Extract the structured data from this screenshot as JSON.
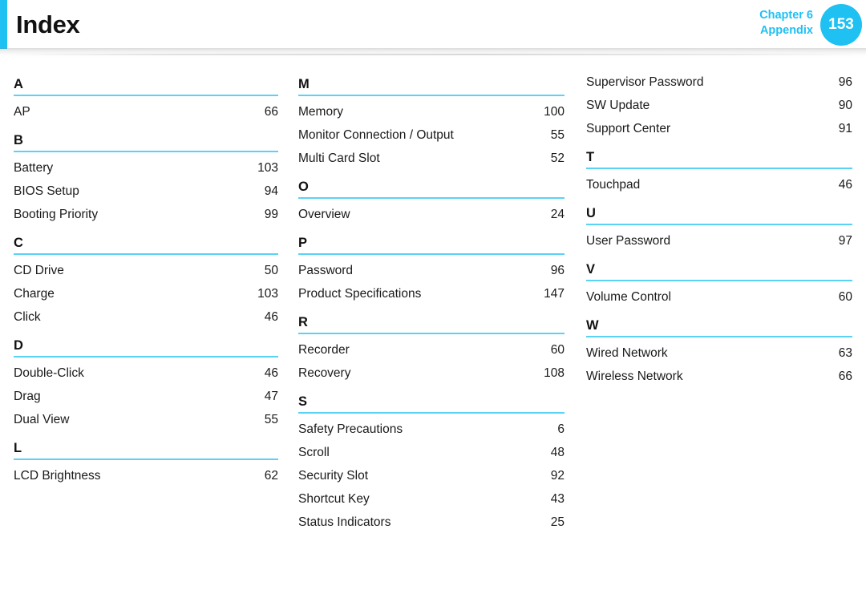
{
  "header": {
    "title": "Index",
    "chapter_line1": "Chapter 6",
    "chapter_line2": "Appendix",
    "page_number": "153",
    "accent_color": "#1fc0f2",
    "rule_color": "#5ad2f6"
  },
  "columns": [
    {
      "sections": [
        {
          "letter": "A",
          "entries": [
            {
              "label": "AP",
              "page": "66"
            }
          ]
        },
        {
          "letter": "B",
          "entries": [
            {
              "label": "Battery",
              "page": "103"
            },
            {
              "label": "BIOS Setup",
              "page": "94"
            },
            {
              "label": "Booting Priority",
              "page": "99"
            }
          ]
        },
        {
          "letter": "C",
          "entries": [
            {
              "label": "CD Drive",
              "page": "50"
            },
            {
              "label": "Charge",
              "page": "103"
            },
            {
              "label": "Click",
              "page": "46"
            }
          ]
        },
        {
          "letter": "D",
          "entries": [
            {
              "label": "Double-Click",
              "page": "46"
            },
            {
              "label": "Drag",
              "page": "47"
            },
            {
              "label": "Dual View",
              "page": "55"
            }
          ]
        },
        {
          "letter": "L",
          "entries": [
            {
              "label": "LCD Brightness",
              "page": "62"
            }
          ]
        }
      ]
    },
    {
      "sections": [
        {
          "letter": "M",
          "entries": [
            {
              "label": "Memory",
              "page": "100"
            },
            {
              "label": "Monitor Connection / Output",
              "page": "55"
            },
            {
              "label": "Multi Card Slot",
              "page": "52"
            }
          ]
        },
        {
          "letter": "O",
          "entries": [
            {
              "label": "Overview",
              "page": "24"
            }
          ]
        },
        {
          "letter": "P",
          "entries": [
            {
              "label": "Password",
              "page": "96"
            },
            {
              "label": "Product Specifications",
              "page": "147"
            }
          ]
        },
        {
          "letter": "R",
          "entries": [
            {
              "label": "Recorder",
              "page": "60"
            },
            {
              "label": "Recovery",
              "page": "108"
            }
          ]
        },
        {
          "letter": "S",
          "entries": [
            {
              "label": "Safety Precautions",
              "page": "6"
            },
            {
              "label": "Scroll",
              "page": "48"
            },
            {
              "label": "Security Slot",
              "page": "92"
            },
            {
              "label": "Shortcut Key",
              "page": "43"
            },
            {
              "label": "Status Indicators",
              "page": "25"
            }
          ]
        }
      ]
    },
    {
      "sections": [
        {
          "letter": "",
          "entries": [
            {
              "label": "Supervisor Password",
              "page": "96"
            },
            {
              "label": "SW Update",
              "page": "90"
            },
            {
              "label": "Support Center",
              "page": "91"
            }
          ]
        },
        {
          "letter": "T",
          "entries": [
            {
              "label": "Touchpad",
              "page": "46"
            }
          ]
        },
        {
          "letter": "U",
          "entries": [
            {
              "label": "User Password",
              "page": "97"
            }
          ]
        },
        {
          "letter": "V",
          "entries": [
            {
              "label": "Volume Control",
              "page": "60"
            }
          ]
        },
        {
          "letter": "W",
          "entries": [
            {
              "label": "Wired Network",
              "page": "63"
            },
            {
              "label": "Wireless Network",
              "page": "66"
            }
          ]
        }
      ]
    }
  ]
}
